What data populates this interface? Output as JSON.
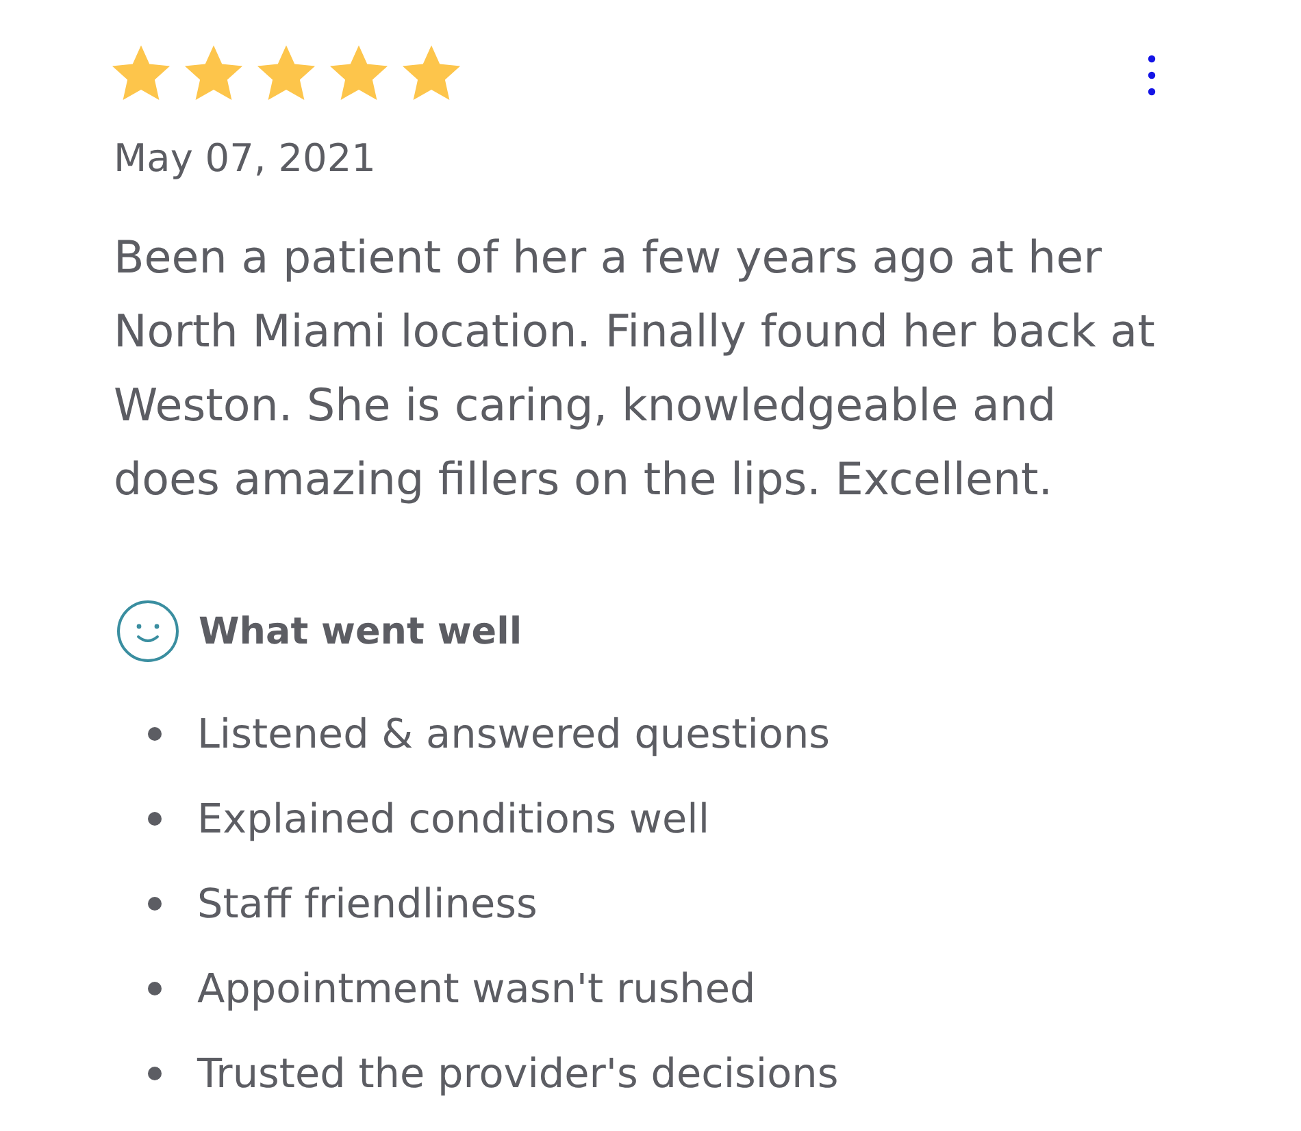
{
  "review": {
    "stars": 5,
    "date": "May 07, 2021",
    "text": "Been a patient of her a few years ago at her North Miami location. Finally found her back at Weston. She is caring, knowledgeable and does amazing fillers on the lips. Excellent."
  },
  "highlights": {
    "title": "What went well",
    "items": [
      "Listened & answered questions",
      "Explained conditions well",
      "Staff friendliness",
      "Appointment wasn't rushed",
      "Trusted the provider's decisions"
    ]
  }
}
